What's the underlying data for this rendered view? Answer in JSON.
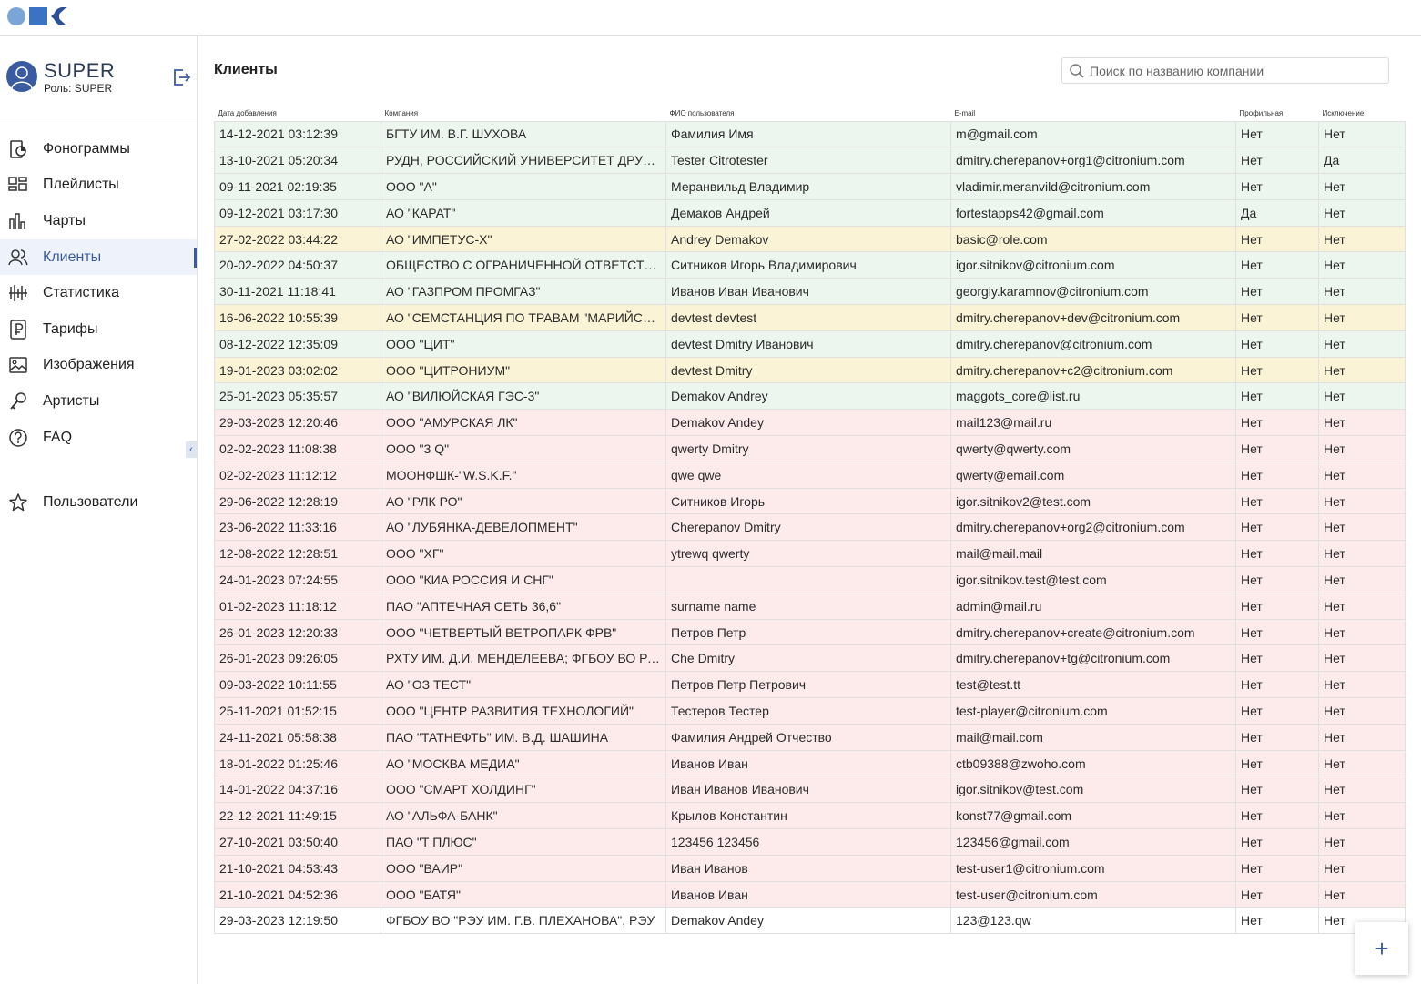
{
  "sidebar": {
    "user": {
      "name": "SUPER",
      "role": "Роль: SUPER"
    },
    "items": [
      {
        "label": "Фонограммы",
        "icon": "phonogram-icon"
      },
      {
        "label": "Плейлисты",
        "icon": "playlist-icon"
      },
      {
        "label": "Чарты",
        "icon": "chart-icon"
      },
      {
        "label": "Клиенты",
        "icon": "clients-icon",
        "active": true
      },
      {
        "label": "Статистика",
        "icon": "statistics-icon"
      },
      {
        "label": "Тарифы",
        "icon": "ruble-icon"
      },
      {
        "label": "Изображения",
        "icon": "image-icon"
      },
      {
        "label": "Артисты",
        "icon": "key-icon"
      },
      {
        "label": "FAQ",
        "icon": "question-icon"
      }
    ],
    "users_item": {
      "label": "Пользователи",
      "icon": "star-icon"
    }
  },
  "main": {
    "title": "Клиенты",
    "search_placeholder": "Поиск по названию компании"
  },
  "table": {
    "headers": [
      "Дата добавления",
      "Компания",
      "ФИО пользователя",
      "E-mail",
      "Профильная",
      "Исключение"
    ],
    "rows": [
      {
        "status": "green",
        "cells": [
          "14-12-2021 03:12:39",
          "БГТУ ИМ. В.Г. ШУХОВА",
          "Фамилия Имя",
          "m@gmail.com",
          "Нет",
          "Нет"
        ]
      },
      {
        "status": "green",
        "cells": [
          "13-10-2021 05:20:34",
          "РУДН, РОССИЙСКИЙ УНИВЕРСИТЕТ ДРУЖБЫ НАРОДОВ",
          "Tester Citrotester",
          "dmitry.cherepanov+org1@citronium.com",
          "Нет",
          "Да"
        ]
      },
      {
        "status": "green",
        "cells": [
          "09-11-2021 02:19:35",
          "ООО \"А\"",
          "Меранвильд Владимир",
          "vladimir.meranvild@citronium.com",
          "Нет",
          "Нет"
        ]
      },
      {
        "status": "green",
        "cells": [
          "09-12-2021 03:17:30",
          "АО \"КАРАТ\"",
          "Демаков Андрей",
          "fortestapps42@gmail.com",
          "Да",
          "Нет"
        ]
      },
      {
        "status": "yellow",
        "cells": [
          "27-02-2022 03:44:22",
          "АО \"ИМПЕТУС-Х\"",
          "Andrey Demakov",
          "basic@role.com",
          "Нет",
          "Нет"
        ]
      },
      {
        "status": "green",
        "cells": [
          "20-02-2022 04:50:37",
          "ОБЩЕСТВО С ОГРАНИЧЕННОЙ ОТВЕТСТВЕННОСТЬЮ",
          "Ситников Игорь Владимирович",
          "igor.sitnikov@citronium.com",
          "Нет",
          "Нет"
        ]
      },
      {
        "status": "green",
        "cells": [
          "30-11-2021 11:18:41",
          "АО \"ГАЗПРОМ ПРОМГАЗ\"",
          "Иванов Иван Иванович",
          "georgiy.karamnov@citronium.com",
          "Нет",
          "Нет"
        ]
      },
      {
        "status": "yellow",
        "cells": [
          "16-06-2022 10:55:39",
          "АО \"СЕМСТАНЦИЯ ПО ТРАВАМ \"МАРИЙСКАЯ\"",
          "devtest devtest",
          "dmitry.cherepanov+dev@citronium.com",
          "Нет",
          "Нет"
        ]
      },
      {
        "status": "green",
        "cells": [
          "08-12-2022 12:35:09",
          "ООО \"ЦИТ\"",
          "devtest Dmitry Иванович",
          "dmitry.cherepanov@citronium.com",
          "Нет",
          "Нет"
        ]
      },
      {
        "status": "yellow",
        "cells": [
          "19-01-2023 03:02:02",
          "ООО \"ЦИТРОНИУМ\"",
          "devtest Dmitry",
          "dmitry.cherepanov+c2@citronium.com",
          "Нет",
          "Нет"
        ]
      },
      {
        "status": "green",
        "cells": [
          "25-01-2023 05:35:57",
          "АО \"ВИЛЮЙСКАЯ ГЭС-3\"",
          "Demakov Andrey",
          "maggots_core@list.ru",
          "Нет",
          "Нет"
        ]
      },
      {
        "status": "red",
        "cells": [
          "29-03-2023 12:20:46",
          "ООО \"АМУРСКАЯ ЛК\"",
          "Demakov Andey",
          "mail123@mail.ru",
          "Нет",
          "Нет"
        ]
      },
      {
        "status": "red",
        "cells": [
          "02-02-2023 11:08:38",
          "ООО \"3 Q\"",
          "qwerty Dmitry",
          "qwerty@qwerty.com",
          "Нет",
          "Нет"
        ]
      },
      {
        "status": "red",
        "cells": [
          "02-02-2023 11:12:12",
          "МООНФШК-\"W.S.K.F.\"",
          "qwe qwe",
          "qwerty@email.com",
          "Нет",
          "Нет"
        ]
      },
      {
        "status": "red",
        "cells": [
          "29-06-2022 12:28:19",
          "АО \"РЛК РО\"",
          "Ситников Игорь",
          "igor.sitnikov2@test.com",
          "Нет",
          "Нет"
        ]
      },
      {
        "status": "red",
        "cells": [
          "23-06-2022 11:33:16",
          "АО \"ЛУБЯНКА-ДЕВЕЛОПМЕНТ\"",
          "Cherepanov Dmitry",
          "dmitry.cherepanov+org2@citronium.com",
          "Нет",
          "Нет"
        ]
      },
      {
        "status": "red",
        "cells": [
          "12-08-2022 12:28:51",
          "ООО \"ХГ\"",
          "ytrewq qwerty",
          "mail@mail.mail",
          "Нет",
          "Нет"
        ]
      },
      {
        "status": "red",
        "cells": [
          "24-01-2023 07:24:55",
          "ООО \"КИА РОССИЯ И СНГ\"",
          "",
          "igor.sitnikov.test@test.com",
          "Нет",
          "Нет"
        ]
      },
      {
        "status": "red",
        "cells": [
          "01-02-2023 11:18:12",
          "ПАО \"АПТЕЧНАЯ СЕТЬ 36,6\"",
          "surname name",
          "admin@mail.ru",
          "Нет",
          "Нет"
        ]
      },
      {
        "status": "red",
        "cells": [
          "26-01-2023 12:20:33",
          "ООО \"ЧЕТВЕРТЫЙ ВЕТРОПАРК ФРВ\"",
          "Петров Петр",
          "dmitry.cherepanov+create@citronium.com",
          "Нет",
          "Нет"
        ]
      },
      {
        "status": "red",
        "cells": [
          "26-01-2023 09:26:05",
          "РХТУ ИМ. Д.И. МЕНДЕЛЕЕВА; ФГБОУ ВО РХТУ",
          "Che Dmitry",
          "dmitry.cherepanov+tg@citronium.com",
          "Нет",
          "Нет"
        ]
      },
      {
        "status": "red",
        "cells": [
          "09-03-2022 10:11:55",
          "АО \"ОЗ ТЕСТ\"",
          "Петров Петр Петрович",
          "test@test.tt",
          "Нет",
          "Нет"
        ]
      },
      {
        "status": "red",
        "cells": [
          "25-11-2021 01:52:15",
          "ООО \"ЦЕНТР РАЗВИТИЯ ТЕХНОЛОГИЙ\"",
          "Тестеров Тестер",
          "test-player@citronium.com",
          "Нет",
          "Нет"
        ]
      },
      {
        "status": "red",
        "cells": [
          "24-11-2021 05:58:38",
          "ПАО \"ТАТНЕФТЬ\" ИМ. В.Д. ШАШИНА",
          "Фамилия Андрей Отчество",
          "mail@mail.com",
          "Нет",
          "Нет"
        ]
      },
      {
        "status": "red",
        "cells": [
          "18-01-2022 01:25:46",
          "АО \"МОСКВА МЕДИА\"",
          "Иванов Иван",
          "ctb09388@zwoho.com",
          "Нет",
          "Нет"
        ]
      },
      {
        "status": "red",
        "cells": [
          "14-01-2022 04:37:16",
          "ООО \"СМАРТ ХОЛДИНГ\"",
          "Иван Иванов Иванович",
          "igor.sitnikov@test.com",
          "Нет",
          "Нет"
        ]
      },
      {
        "status": "red",
        "cells": [
          "22-12-2021 11:49:15",
          "АО \"АЛЬФА-БАНК\"",
          "Крылов Константин",
          "konst77@gmail.com",
          "Нет",
          "Нет"
        ]
      },
      {
        "status": "red",
        "cells": [
          "27-10-2021 03:50:40",
          "ПАО \"Т ПЛЮС\"",
          "123456 123456",
          "123456@gmail.com",
          "Нет",
          "Нет"
        ]
      },
      {
        "status": "red",
        "cells": [
          "21-10-2021 04:53:43",
          "ООО \"ВАИР\"",
          "Иван Иванов",
          "test-user1@citronium.com",
          "Нет",
          "Нет"
        ]
      },
      {
        "status": "red",
        "cells": [
          "21-10-2021 04:52:36",
          "ООО \"БАТЯ\"",
          "Иванов Иван",
          "test-user@citronium.com",
          "Нет",
          "Нет"
        ]
      },
      {
        "status": "white",
        "cells": [
          "29-03-2023 12:19:50",
          "ФГБОУ ВО \"РЭУ ИМ. Г.В. ПЛЕХАНОВА\", РЭУ",
          "Demakov Andey",
          "123@123.qw",
          "Нет",
          "Нет"
        ]
      }
    ]
  },
  "fab": {
    "label": "+"
  },
  "colors": {
    "accent": "#3a5ba0",
    "row_green": "#ecf5ee",
    "row_yellow": "#fbf3d6",
    "row_red": "#fdebec"
  }
}
